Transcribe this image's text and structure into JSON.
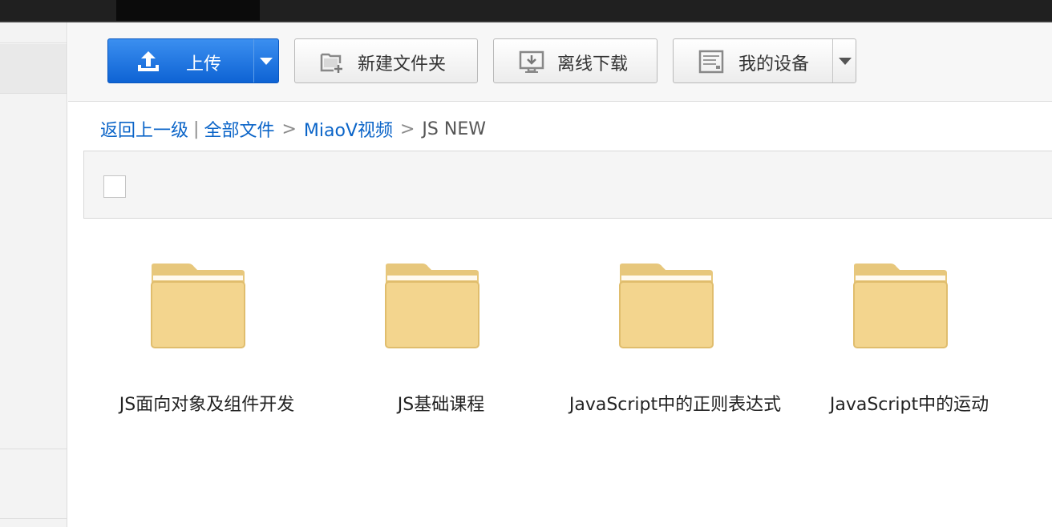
{
  "toolbar": {
    "upload_label": "上传",
    "new_folder_label": "新建文件夹",
    "offline_download_label": "离线下载",
    "my_devices_label": "我的设备"
  },
  "breadcrumb": {
    "back_label": "返回上一级",
    "divider": "|",
    "items": [
      "全部文件",
      "MiaoV视频",
      "JS NEW"
    ],
    "separator": ">"
  },
  "folders": [
    {
      "name": "JS面向对象及组件开发",
      "icon": "folder-icon"
    },
    {
      "name": "JS基础课程",
      "icon": "folder-icon"
    },
    {
      "name": "JavaScript中的正则表达式",
      "icon": "folder-icon"
    },
    {
      "name": "JavaScript中的运动",
      "icon": "folder-icon"
    }
  ],
  "colors": {
    "primary": "#0e63d4",
    "link": "#0a64c8",
    "folder": "#f3d58e"
  }
}
